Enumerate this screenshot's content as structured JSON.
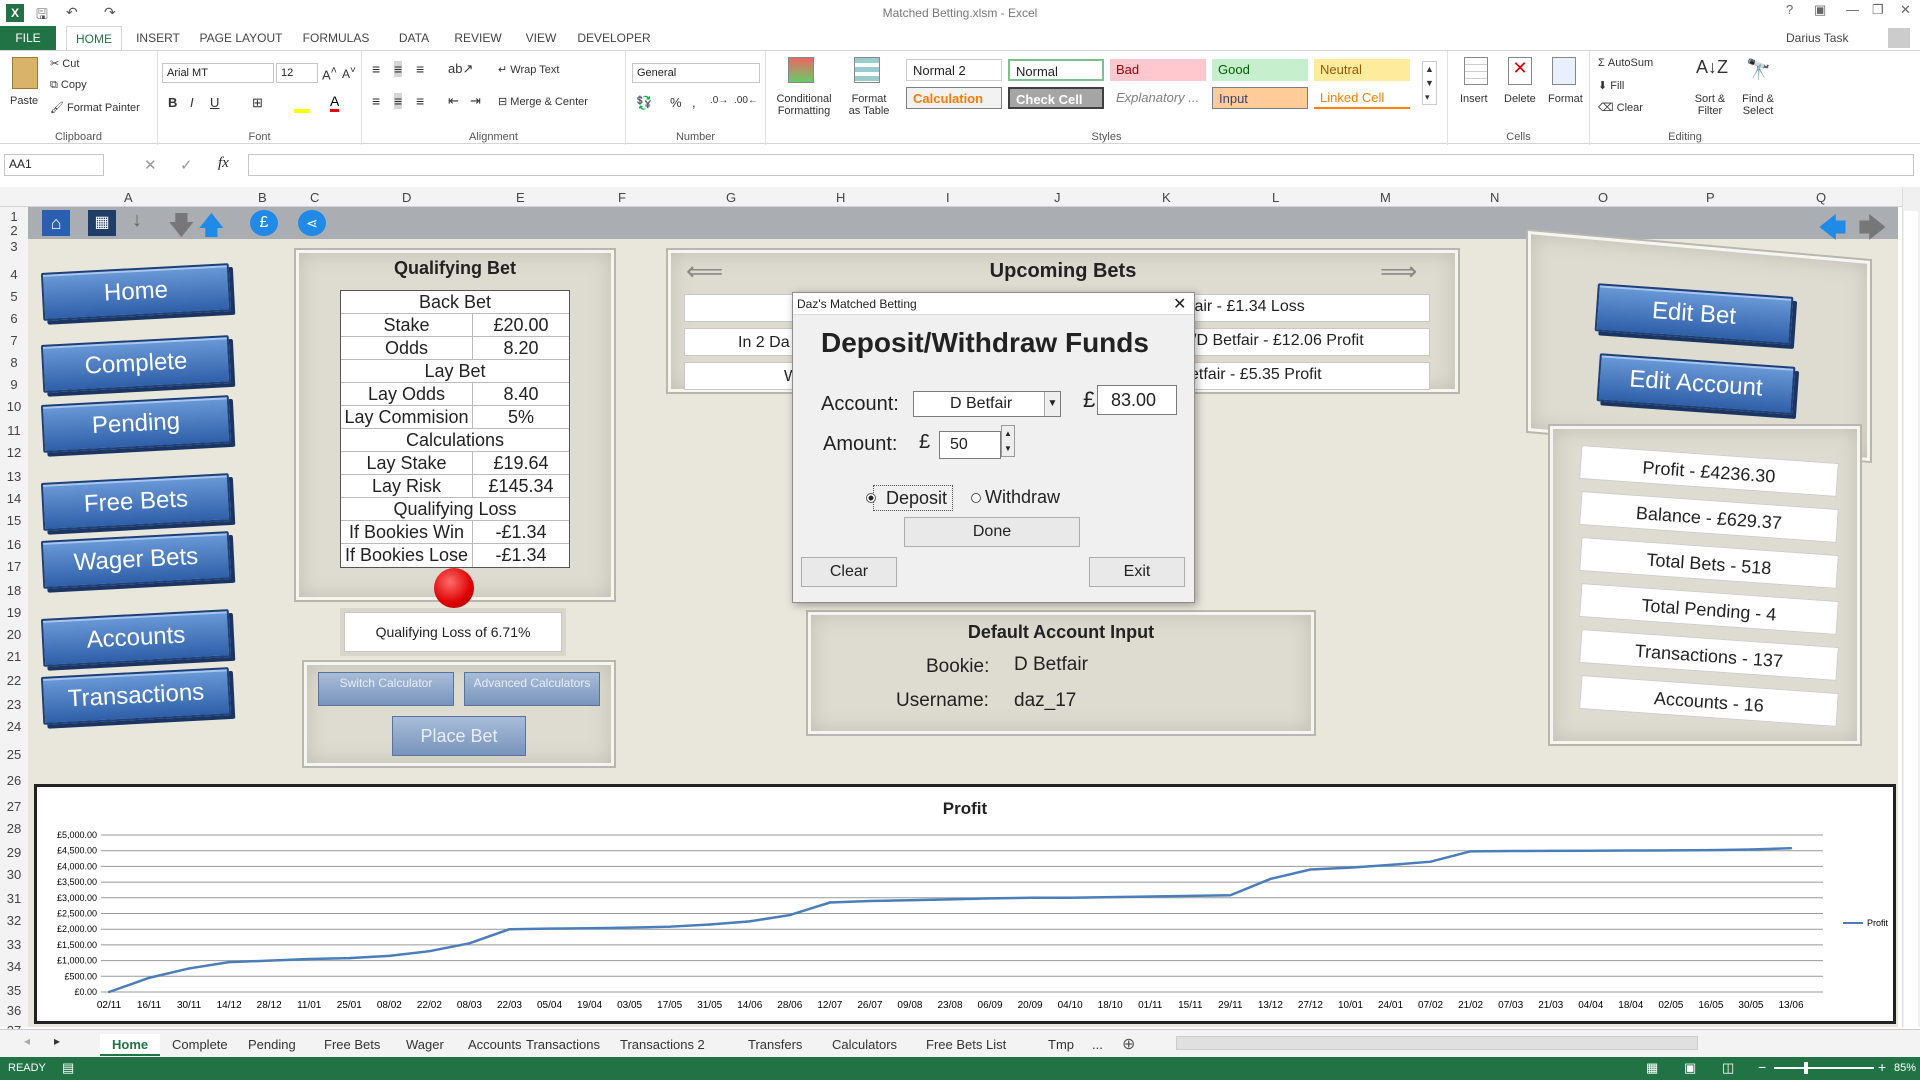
{
  "window": {
    "title": "Matched Betting.xlsm - Excel",
    "user": "Darius Task"
  },
  "ribbon_tabs": [
    "FILE",
    "HOME",
    "INSERT",
    "PAGE LAYOUT",
    "FORMULAS",
    "DATA",
    "REVIEW",
    "VIEW",
    "DEVELOPER"
  ],
  "clipboard": {
    "paste": "Paste",
    "cut": "Cut",
    "copy": "Copy",
    "format_painter": "Format Painter",
    "label": "Clipboard"
  },
  "font": {
    "name": "Arial MT",
    "size": "12",
    "label": "Font"
  },
  "alignment": {
    "wrap": "Wrap Text",
    "merge": "Merge & Center",
    "label": "Alignment"
  },
  "number": {
    "format": "General",
    "label": "Number"
  },
  "styles": {
    "conditional": "Conditional Formatting",
    "format_table": "Format as Table",
    "label": "Styles",
    "items": [
      "Normal 2",
      "Normal",
      "Bad",
      "Good",
      "Neutral",
      "Calculation",
      "Check Cell",
      "Explanatory ...",
      "Input",
      "Linked Cell"
    ]
  },
  "cells": {
    "insert": "Insert",
    "delete": "Delete",
    "format": "Format",
    "label": "Cells"
  },
  "editing": {
    "autosum": "AutoSum",
    "fill": "Fill",
    "clear": "Clear",
    "sort": "Sort & Filter",
    "find": "Find & Select",
    "label": "Editing"
  },
  "formula_bar": {
    "name_box": "AA1",
    "fx": "fx",
    "content": ""
  },
  "columns": [
    "A",
    "B",
    "C",
    "D",
    "E",
    "F",
    "G",
    "H",
    "I",
    "J",
    "K",
    "L",
    "M",
    "N",
    "O",
    "P",
    "Q"
  ],
  "rows": [
    "1",
    "2",
    "3",
    "4",
    "5",
    "6",
    "7",
    "8",
    "9",
    "10",
    "11",
    "12",
    "13",
    "14",
    "15",
    "16",
    "17",
    "18",
    "19",
    "20",
    "21",
    "22",
    "23",
    "24",
    "25",
    "26",
    "27",
    "28",
    "29",
    "30",
    "31",
    "32",
    "33",
    "34",
    "35",
    "36",
    "37"
  ],
  "nav_buttons": [
    "Home",
    "Complete",
    "Pending",
    "Free Bets",
    "Wager Bets",
    "Accounts",
    "Transactions"
  ],
  "qualifying": {
    "title": "Qualifying Bet",
    "back_header": "Back Bet",
    "rows1": [
      [
        "Stake",
        "£20.00"
      ],
      [
        "Odds",
        "8.20"
      ]
    ],
    "lay_header": "Lay Bet",
    "rows2": [
      [
        "Lay Odds",
        "8.40"
      ],
      [
        "Lay Commision",
        "5%"
      ]
    ],
    "calc_header": "Calculations",
    "rows3": [
      [
        "Lay Stake",
        "£19.64"
      ],
      [
        "Lay Risk",
        "£145.34"
      ]
    ],
    "loss_header": "Qualifying Loss",
    "rows4": [
      [
        "If Bookies Win",
        "-£1.34"
      ],
      [
        "If Bookies Lose",
        "-£1.34"
      ]
    ],
    "summary": "Qualifying Loss of 6.71%",
    "switch": "Switch Calculator",
    "advanced": "Advanced Calculators",
    "place": "Place Bet"
  },
  "upcoming": {
    "title": "Upcoming Bets",
    "items": [
      "fair - £1.34 Loss",
      "/D Betfair - £12.06 Profit",
      "etfair - £5.35 Profit"
    ],
    "left_partial": [
      "In 2 Da",
      "W"
    ]
  },
  "default_account": {
    "title": "Default Account Input",
    "bookie_label": "Bookie:",
    "bookie": "D Betfair",
    "username_label": "Username:",
    "username": "daz_17"
  },
  "right": {
    "edit_bet": "Edit Bet",
    "edit_account": "Edit Account",
    "stats": [
      "Profit - £4236.30",
      "Balance - £629.37",
      "Total Bets - 518",
      "Total Pending - 4",
      "Transactions - 137",
      "Accounts - 16"
    ]
  },
  "dialog": {
    "caption": "Daz's Matched Betting",
    "heading": "Deposit/Withdraw Funds",
    "account_label": "Account:",
    "account_value": "D Betfair",
    "currency": "£",
    "balance": "83.00",
    "amount_label": "Amount:",
    "amount": "50",
    "deposit": "Deposit",
    "withdraw": "Withdraw",
    "done": "Done",
    "clear": "Clear",
    "exit": "Exit"
  },
  "chart_data": {
    "type": "line",
    "title": "Profit",
    "legend": "Profit",
    "legend_position": "right",
    "grid": true,
    "ylim": [
      0,
      5000
    ],
    "y_ticks": [
      "£0.00",
      "£500.00",
      "£1,000.00",
      "£1,500.00",
      "£2,000.00",
      "£2,500.00",
      "£3,000.00",
      "£3,500.00",
      "£4,000.00",
      "£4,500.00",
      "£5,000.00"
    ],
    "x": [
      "02/11",
      "16/11",
      "30/11",
      "14/12",
      "28/12",
      "11/01",
      "25/01",
      "08/02",
      "22/02",
      "08/03",
      "22/03",
      "05/04",
      "19/04",
      "03/05",
      "17/05",
      "31/05",
      "14/06",
      "28/06",
      "12/07",
      "26/07",
      "09/08",
      "23/08",
      "06/09",
      "20/09",
      "04/10",
      "18/10",
      "01/11",
      "15/11",
      "29/11",
      "13/12",
      "27/12",
      "10/01",
      "24/01",
      "07/02",
      "21/02",
      "07/03",
      "21/03",
      "04/04",
      "18/04",
      "02/05",
      "16/05",
      "30/05",
      "13/06"
    ],
    "series": [
      {
        "name": "Profit",
        "values": [
          0,
          450,
          750,
          950,
          1000,
          1050,
          1080,
          1150,
          1300,
          1550,
          2000,
          2020,
          2030,
          2050,
          2080,
          2150,
          2250,
          2450,
          2850,
          2900,
          2920,
          2950,
          2980,
          3000,
          3000,
          3020,
          3040,
          3060,
          3080,
          3600,
          3900,
          3960,
          4050,
          4150,
          4480,
          4490,
          4495,
          4500,
          4505,
          4510,
          4520,
          4540,
          4580
        ]
      }
    ]
  },
  "sheet_tabs": [
    "Home",
    "Complete",
    "Pending",
    "Free Bets",
    "Wager",
    "Accounts",
    "Transactions",
    "Transactions 2",
    "Transfers",
    "Calculators",
    "Free Bets List",
    "Tmp"
  ],
  "status": {
    "ready": "READY",
    "zoom": "85%"
  }
}
